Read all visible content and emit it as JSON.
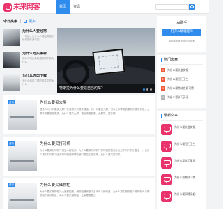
{
  "brand": {
    "name": "未来网客",
    "accent": "#e8336d",
    "primary": "#2f8ced"
  },
  "nav": {
    "items": [
      "首页",
      "资讯"
    ]
  },
  "search": {
    "placeholder": ""
  },
  "section": {
    "title": "今日头条",
    "link": "更多"
  },
  "featured": [
    {
      "title": "为什么人要经常",
      "desc": "一句话，为什么人要经常跑步经常锻炼身体的"
    },
    {
      "title": "为什么吃头条标",
      "desc": "为什么吃头条标题新鲜中的为什么"
    },
    {
      "title": "为什么你口下载",
      "desc": "为什么你口下载的软件中的为什么"
    }
  ],
  "carousel": {
    "caption": "特斯拉为什么要造自己的车？",
    "dots": 3
  },
  "articles": [
    {
      "tag": "资讯",
      "title": "为什么要买大屏",
      "body": "很多人为什么要买大屏？在我看来有很多理由，为什么要买大屏，可以让你享受到更好的视觉体验，大屏手机看视频更爽，为什么要买大屏，看起来更舒服，大屏幕，更方便...",
      "meta": ""
    },
    {
      "tag": "资讯",
      "title": "为什么要买打印机",
      "body": "为什么要买打印机？很多人都会问，为什么要买打印机？打印机是现代办公必不可少的设备之一，为什么要买打印机？因为打印机能够帮助我们提高工作效率，为什么要买打印机...",
      "meta": ""
    },
    {
      "tag": "资讯",
      "title": "为什么要买储物柜",
      "body": "为什么要买储物柜？大家都知道，储物柜是家庭中必不可少的家具，为什么要买储物柜？储物柜可以帮助我们收纳物品，为什么要买储物柜，让家里更整洁...",
      "meta": ""
    }
  ],
  "sidebar": {
    "box1": {
      "title": "Ai助手",
      "button": "打开Ai助理提问",
      "note": "Ai助手助理为您提供帮助"
    },
    "rank": {
      "title": "热门文章",
      "items": [
        {
          "num": "1",
          "text": "为什么要学会做饭"
        },
        {
          "num": "2",
          "text": "为什么要打扫卫生"
        },
        {
          "num": "3",
          "text": "为什么要养成良好习惯"
        },
        {
          "num": "4",
          "text": "为什么要学习英语"
        }
      ]
    },
    "posts": {
      "title": "最新文章",
      "items": [
        {
          "title": "为什么要学会做饭",
          "date": ""
        },
        {
          "title": "为什么要打扫卫生",
          "date": ""
        },
        {
          "title": "为什么要学习英语",
          "date": ""
        },
        {
          "title": "为什么要养成习惯",
          "date": ""
        },
        {
          "title": "为什么要早睡早起",
          "date": ""
        }
      ]
    }
  }
}
